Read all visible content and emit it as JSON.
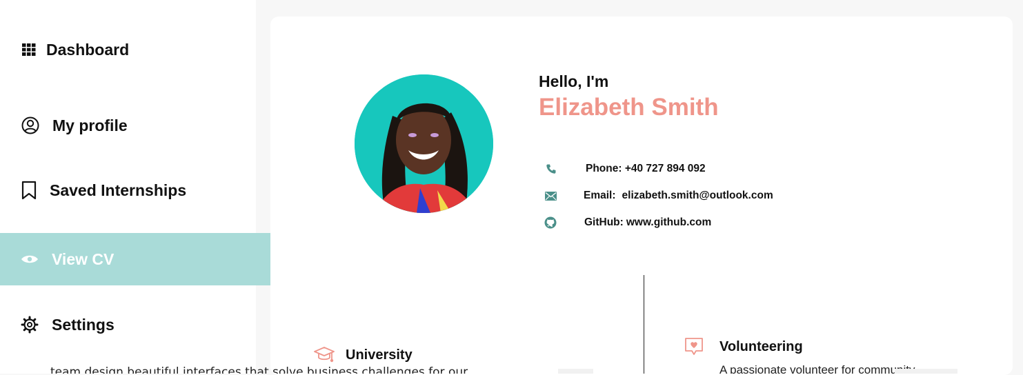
{
  "sidebar": {
    "items": [
      {
        "label": "Dashboard",
        "icon": "grid-icon"
      },
      {
        "label": "My profile",
        "icon": "user-circle-icon"
      },
      {
        "label": "Saved Internships",
        "icon": "bookmark-icon"
      },
      {
        "label": "View CV",
        "icon": "eye-icon",
        "active": true
      },
      {
        "label": "Settings",
        "icon": "gear-icon"
      }
    ],
    "active_color": "#a9dbd8"
  },
  "profile": {
    "greeting": "Hello, I'm",
    "name": "Elizabeth Smith",
    "name_color": "#ef958a",
    "phone_label": "Phone: +40 727 894 092",
    "email_label": "Email:",
    "email_value": "elizabeth.smith@outlook.com",
    "github_label": "GitHub:",
    "github_value": "www.github.com"
  },
  "sections": {
    "university": "University",
    "volunteering": "Volunteering"
  },
  "partial_text": {
    "left": "team design beautiful interfaces that solve business challenges for our",
    "right": "A passionate volunteer for community"
  },
  "colors": {
    "accent_teal": "#4a8f89",
    "accent_pink": "#ef958a",
    "avatar_bg": "#17c7bd"
  }
}
